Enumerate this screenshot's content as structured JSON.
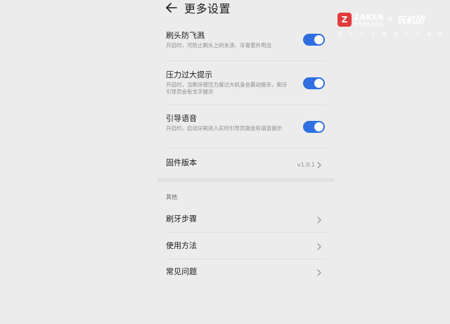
{
  "header": {
    "title": "更多设置"
  },
  "settings": [
    {
      "title": "刷头防飞溅",
      "desc": "开启时，可防止刷头上的水渍、牙膏意外甩出",
      "toggle": "on"
    },
    {
      "title": "压力过大提示",
      "desc": "开启时，当刷牙按压力度过大机身会震动提示，刷牙引导页会有文字提示",
      "toggle": "on"
    },
    {
      "title": "引导语音",
      "desc": "开启时，启动牙刷进入实时引导页面会有语音提示",
      "toggle": "on"
    }
  ],
  "firmware": {
    "label": "固件版本",
    "version": "v1.0.1"
  },
  "other": {
    "section_label": "其他",
    "items": [
      {
        "label": "刷牙步骤"
      },
      {
        "label": "使用方法"
      },
      {
        "label": "常见问题"
      }
    ]
  },
  "watermark": {
    "logo_letter": "Z",
    "brand": "ZAKER",
    "brand_sub": "新传媒旗舰频道",
    "separator": "×",
    "partner": "玩机团",
    "tagline": "信 传 天 上 事 就 问 专 家 团"
  },
  "colors": {
    "accent": "#2f6fe2",
    "background": "#ececec",
    "watermark_red": "#e23b3b"
  }
}
